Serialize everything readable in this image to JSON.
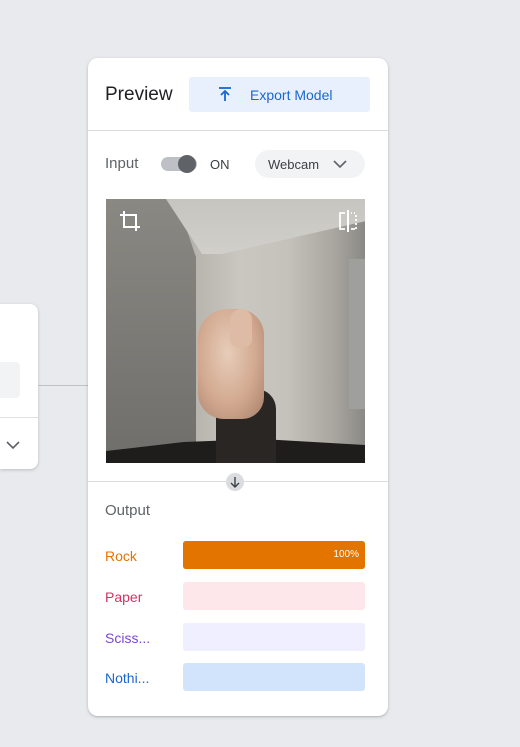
{
  "preview": {
    "title": "Preview",
    "export_button": "Export Model"
  },
  "input": {
    "label": "Input",
    "toggle_state": "ON",
    "source_select": "Webcam"
  },
  "output": {
    "label": "Output",
    "classes": [
      {
        "label": "Rock",
        "percent_text": "100%",
        "confidence": 1.0,
        "color": "#e37400",
        "track": "#e37400"
      },
      {
        "label": "Paper",
        "percent_text": "",
        "confidence": 0.0,
        "color": "#d93062",
        "track": "#fde7ea"
      },
      {
        "label": "Sciss...",
        "percent_text": "",
        "confidence": 0.0,
        "color": "#7b46d8",
        "track": "#f0efff"
      },
      {
        "label": "Nothi...",
        "percent_text": "",
        "confidence": 0.0,
        "color": "#1967d2",
        "track": "#d2e3fc"
      }
    ]
  },
  "icons": {
    "export": "upload-icon",
    "select": "chevron-down-icon",
    "crop": "crop-icon",
    "flip": "flip-icon",
    "arrow": "arrow-down-icon"
  },
  "colors": {
    "accent": "#1967d2",
    "accent_bg": "#e8f0fe",
    "background": "#e8eaed"
  }
}
